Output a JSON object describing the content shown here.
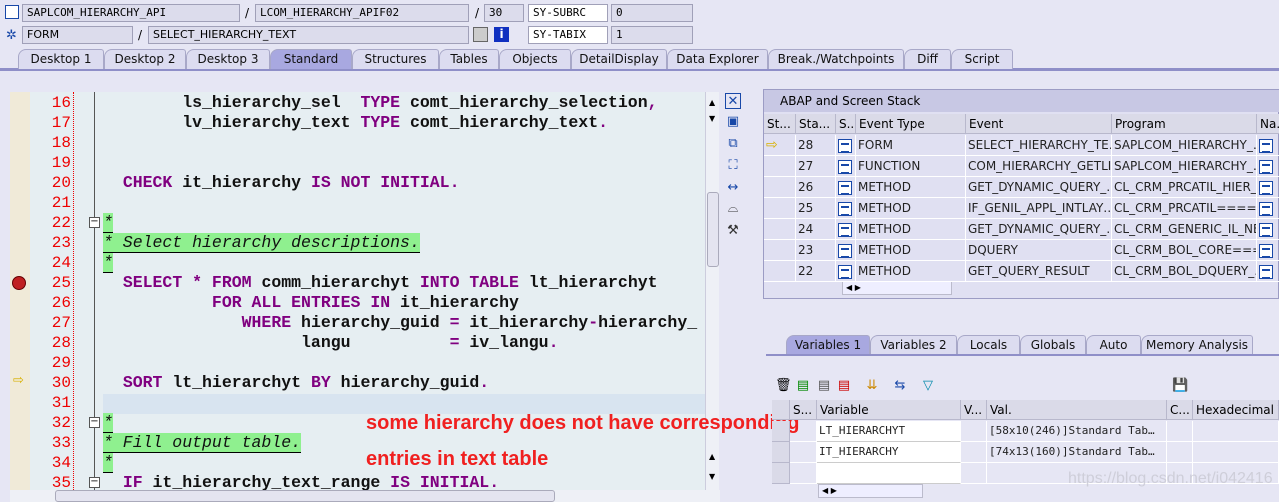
{
  "header": {
    "program": "SAPLCOM_HIERARCHY_API",
    "include": "LCOM_HIERARCHY_APIF02",
    "line": "30",
    "sy1_label": "SY-SUBRC",
    "sy1_value": "0",
    "event_type": "FORM",
    "event": "SELECT_HIERARCHY_TEXT",
    "sy2_label": "SY-TABIX",
    "sy2_value": "1",
    "sep": "/"
  },
  "tabs": [
    "Desktop 1",
    "Desktop 2",
    "Desktop 3",
    "Standard",
    "Structures",
    "Tables",
    "Objects",
    "DetailDisplay",
    "Data Explorer",
    "Break./Watchpoints",
    "Diff",
    "Script"
  ],
  "active_tab": "Standard",
  "code": {
    "lines": [
      {
        "n": "16",
        "parts": [
          [
            "        ls_hierarchy_sel  ",
            ""
          ],
          [
            "TYPE",
            "kw"
          ],
          [
            " comt_hierarchy_selection",
            ""
          ],
          [
            ",",
            "kw"
          ]
        ]
      },
      {
        "n": "17",
        "parts": [
          [
            "        lv_hierarchy_text ",
            ""
          ],
          [
            "TYPE",
            "kw"
          ],
          [
            " comt_hierarchy_text",
            ""
          ],
          [
            ".",
            "kw"
          ]
        ]
      },
      {
        "n": "18",
        "parts": []
      },
      {
        "n": "19",
        "parts": []
      },
      {
        "n": "20",
        "parts": [
          [
            "  ",
            ""
          ],
          [
            "CHECK",
            "kw"
          ],
          [
            " it_hierarchy ",
            ""
          ],
          [
            "IS NOT INITIAL.",
            "kw"
          ]
        ]
      },
      {
        "n": "21",
        "parts": []
      },
      {
        "n": "22",
        "parts": [
          [
            "*",
            "cm"
          ]
        ]
      },
      {
        "n": "23",
        "parts": [
          [
            "* Select hierarchy descriptions.",
            "cm"
          ]
        ]
      },
      {
        "n": "24",
        "parts": [
          [
            "*",
            "cm"
          ]
        ]
      },
      {
        "n": "25",
        "parts": [
          [
            "  ",
            ""
          ],
          [
            "SELECT * FROM",
            "kw"
          ],
          [
            " comm_hierarchyt ",
            ""
          ],
          [
            "INTO TABLE",
            "kw"
          ],
          [
            " lt_hierarchyt",
            ""
          ]
        ]
      },
      {
        "n": "26",
        "parts": [
          [
            "           ",
            ""
          ],
          [
            "FOR ALL ENTRIES IN",
            "kw"
          ],
          [
            " it_hierarchy",
            ""
          ]
        ]
      },
      {
        "n": "27",
        "parts": [
          [
            "              ",
            ""
          ],
          [
            "WHERE",
            "kw"
          ],
          [
            " hierarchy_guid ",
            ""
          ],
          [
            "=",
            "kw"
          ],
          [
            " it_hierarchy",
            ""
          ],
          [
            "-",
            "kw"
          ],
          [
            "hierarchy_",
            ""
          ]
        ]
      },
      {
        "n": "28",
        "parts": [
          [
            "                    langu          ",
            ""
          ],
          [
            "=",
            "kw"
          ],
          [
            " iv_langu",
            ""
          ],
          [
            ".",
            "kw"
          ]
        ]
      },
      {
        "n": "29",
        "parts": []
      },
      {
        "n": "30",
        "parts": [
          [
            "  ",
            ""
          ],
          [
            "SORT",
            "kw"
          ],
          [
            " lt_hierarchyt ",
            ""
          ],
          [
            "BY",
            "kw"
          ],
          [
            " hierarchy_guid",
            ""
          ],
          [
            ".",
            "kw"
          ]
        ]
      },
      {
        "n": "31",
        "parts": []
      },
      {
        "n": "32",
        "parts": [
          [
            "*",
            "cm"
          ]
        ]
      },
      {
        "n": "33",
        "parts": [
          [
            "* Fill output table.",
            "cm"
          ]
        ]
      },
      {
        "n": "34",
        "parts": [
          [
            "*",
            "cm"
          ]
        ]
      },
      {
        "n": "35",
        "parts": [
          [
            "  ",
            ""
          ],
          [
            "IF",
            "kw"
          ],
          [
            " it_hierarchy_text_range ",
            ""
          ],
          [
            "IS INITIAL.",
            "kw"
          ]
        ]
      }
    ]
  },
  "annotation": [
    "some hierarchy does not have corresponding",
    "entries in text table"
  ],
  "stack": {
    "title": "ABAP and Screen Stack",
    "columns": [
      "St...",
      "Sta...",
      "S..",
      "Event Type",
      "Event",
      "Program",
      "Na.."
    ],
    "rows": [
      {
        "current": true,
        "level": "28",
        "type": "FORM",
        "event": "SELECT_HIERARCHY_TE…",
        "program": "SAPLCOM_HIERARCHY_…"
      },
      {
        "current": false,
        "level": "27",
        "type": "FUNCTION",
        "event": "COM_HIERARCHY_GETLI…",
        "program": "SAPLCOM_HIERARCHY_…"
      },
      {
        "current": false,
        "level": "26",
        "type": "METHOD",
        "event": "GET_DYNAMIC_QUERY_…",
        "program": "CL_CRM_PRCATIL_HIER_…"
      },
      {
        "current": false,
        "level": "25",
        "type": "METHOD",
        "event": "IF_GENIL_APPL_INTLAY…",
        "program": "CL_CRM_PRCATIL====…"
      },
      {
        "current": false,
        "level": "24",
        "type": "METHOD",
        "event": "GET_DYNAMIC_QUERY_…",
        "program": "CL_CRM_GENERIC_IL_NE…"
      },
      {
        "current": false,
        "level": "23",
        "type": "METHOD",
        "event": "DQUERY",
        "program": "CL_CRM_BOL_CORE===…"
      },
      {
        "current": false,
        "level": "22",
        "type": "METHOD",
        "event": "GET_QUERY_RESULT",
        "program": "CL_CRM_BOL_DQUERY_…"
      }
    ]
  },
  "var_tabs": [
    "Variables 1",
    "Variables 2",
    "Locals",
    "Globals",
    "Auto",
    "Memory Analysis"
  ],
  "vars": {
    "columns": [
      "S...",
      "Variable",
      "V...",
      "Val.",
      "C...",
      "Hexadecimal Va"
    ],
    "rows": [
      {
        "name": "LT_HIERARCHYT",
        "val": "[58x10(246)]Standard Tab…"
      },
      {
        "name": "IT_HIERARCHY",
        "val": "[74x13(160)]Standard Tab…"
      },
      {
        "name": "",
        "val": ""
      }
    ]
  },
  "watermark": "https://blog.csdn.net/i042416"
}
